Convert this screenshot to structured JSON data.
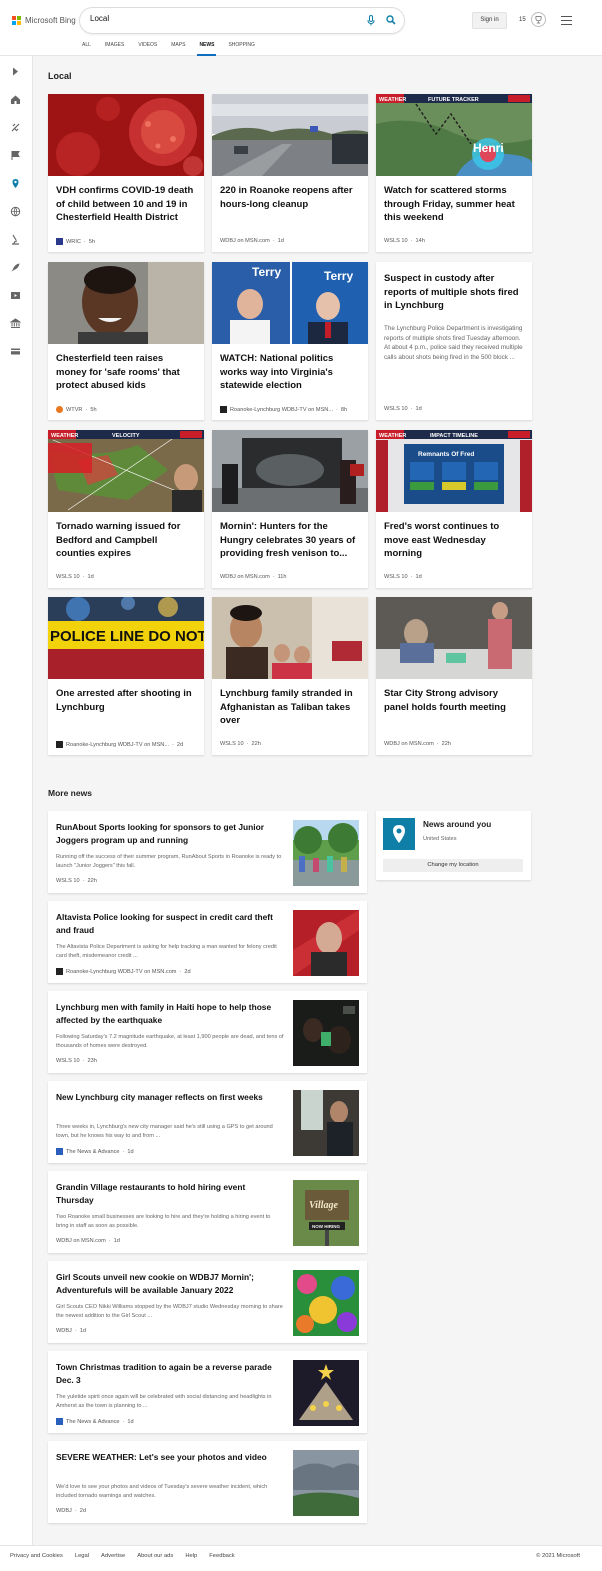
{
  "header": {
    "logo_text": "Microsoft Bing",
    "search_value": "Local",
    "signin_label": "Sign in",
    "rewards_count": "15"
  },
  "nav": {
    "tabs": [
      {
        "label": "ALL"
      },
      {
        "label": "IMAGES"
      },
      {
        "label": "VIDEOS"
      },
      {
        "label": "MAPS"
      },
      {
        "label": "NEWS",
        "active": true
      },
      {
        "label": "SHOPPING"
      }
    ]
  },
  "sidebar": {
    "icons": [
      "expand-icon",
      "home-icon",
      "satellite-icon",
      "flag-icon",
      "location-icon",
      "globe-icon",
      "microscope-icon",
      "rocket-icon",
      "video-icon",
      "bank-icon",
      "card-icon"
    ]
  },
  "main": {
    "title": "Local",
    "cards": [
      {
        "title": "VDH confirms COVID-19 death of child between 10 and 19 in Chesterfield Health District",
        "source": "WRIC",
        "time": "5h"
      },
      {
        "title": "220 in Roanoke reopens after hours-long cleanup",
        "source": "WDBJ on MSN.com",
        "time": "1d"
      },
      {
        "title": "Watch for scattered storms through Friday, summer heat this weekend",
        "source": "WSLS 10",
        "time": "14h"
      },
      {
        "title": "Chesterfield teen raises money for 'safe rooms' that protect abused kids",
        "source": "WTVR",
        "time": "5h"
      },
      {
        "title": "WATCH: National politics works way into Virginia's statewide election",
        "source": "Roanoke-Lynchburg WDBJ-TV on MSN...",
        "time": "8h"
      },
      {
        "title": "Suspect in custody after reports of multiple shots fired in Lynchburg",
        "snippet": "The Lynchburg Police Department is investigating reports of multiple shots fired Tuesday afternoon. At about 4 p.m., police said they received multiple calls about shots being fired in the 500 block ...",
        "source": "WSLS 10",
        "time": "1d"
      },
      {
        "title": "Tornado warning issued for Bedford and Campbell counties expires",
        "source": "WSLS 10",
        "time": "1d"
      },
      {
        "title": "Mornin': Hunters for the Hungry celebrates 30 years of providing fresh venison to...",
        "source": "WDBJ on MSN.com",
        "time": "11h"
      },
      {
        "title": "Fred's worst continues to move east Wednesday morning",
        "source": "WSLS 10",
        "time": "1d"
      },
      {
        "title": "One arrested after shooting in Lynchburg",
        "source": "Roanoke-Lynchburg WDBJ-TV on MSN...",
        "time": "2d"
      },
      {
        "title": "Lynchburg family stranded in Afghanistan as Taliban takes over",
        "source": "WSLS 10",
        "time": "22h"
      },
      {
        "title": "Star City Strong advisory panel holds fourth meeting",
        "source": "WDBJ on MSN.com",
        "time": "22h"
      }
    ],
    "image_text": {
      "henri": "Henri",
      "future_tracker": "FUTURE TRACKER",
      "weather": "WEATHER",
      "velocity": "VELOCITY",
      "impact_timeline": "IMPACT TIMELINE",
      "remnants": "Remnants Of Fred",
      "police_tape": "POLICE LINE DO NOT CROSS",
      "sign_terry": "Terry",
      "village": "Village",
      "hiring": "NOW HIRING"
    }
  },
  "more_news": {
    "title": "More news",
    "items": [
      {
        "title": "RunAbout Sports looking for sponsors to get Junior Joggers program up and running",
        "snippet": "Running off the success of their summer program, RunAbout Sports in Roanoke is ready to launch \"Junior Joggers\" this fall.",
        "source": "WSLS 10",
        "time": "22h"
      },
      {
        "title": "Altavista Police looking for suspect in credit card theft and fraud",
        "snippet": "The Altavista Police Department is asking for help tracking a man wanted for felony credit card theft, misdemeanor credit ...",
        "source": "Roanoke-Lynchburg WDBJ-TV on MSN.com",
        "time": "2d"
      },
      {
        "title": "Lynchburg men with family in Haiti hope to help those affected by the earthquake",
        "snippet": "Following Saturday's 7.2 magnitude earthquake, at least 1,900 people are dead, and tens of thousands of homes were destroyed.",
        "source": "WSLS 10",
        "time": "23h"
      },
      {
        "title": "New Lynchburg city manager reflects on first weeks",
        "snippet": "Three weeks in, Lynchburg's new city manager said he's still using a GPS to get around town, but he knows his way to and from ...",
        "source": "The News & Advance",
        "time": "1d"
      },
      {
        "title": "Grandin Village restaurants to hold hiring event Thursday",
        "snippet": "Two Roanoke small businesses are looking to hire and they're holding a hiring event to bring in staff as soon as possible.",
        "source": "WDBJ on MSN.com",
        "time": "1d"
      },
      {
        "title": "Girl Scouts unveil new cookie on WDBJ7 Mornin'; Adventurefuls will be available January 2022",
        "snippet": "Girl Scouts CEO Nikki Williams stopped by the WDBJ7 studio Wednesday morning to share the newest addition to the Girl Scout ...",
        "source": "WDBJ",
        "time": "1d"
      },
      {
        "title": "Town Christmas tradition to again be a reverse parade Dec. 3",
        "snippet": "The yuletide spirit once again will be celebrated with social distancing and headlights in Amherst as the town is planning to ...",
        "source": "The News & Advance",
        "time": "1d"
      },
      {
        "title": "SEVERE WEATHER: Let's see your photos and video",
        "snippet": "We'd love to see your photos and videos of Tuesday's severe weather incident, which included tornado warnings and watches.",
        "source": "WDBJ",
        "time": "2d"
      }
    ]
  },
  "news_around": {
    "title": "News around you",
    "location": "United States",
    "button_label": "Change my location"
  },
  "footer": {
    "links": [
      "Privacy and Cookies",
      "Legal",
      "Advertise",
      "About our ads",
      "Help",
      "Feedback"
    ],
    "copyright": "© 2021 Microsoft"
  },
  "colors": {
    "accent": "#106ebe",
    "pin": "#0f7fa8",
    "logo": [
      "#f25022",
      "#7fba00",
      "#00a4ef",
      "#ffb900"
    ]
  }
}
